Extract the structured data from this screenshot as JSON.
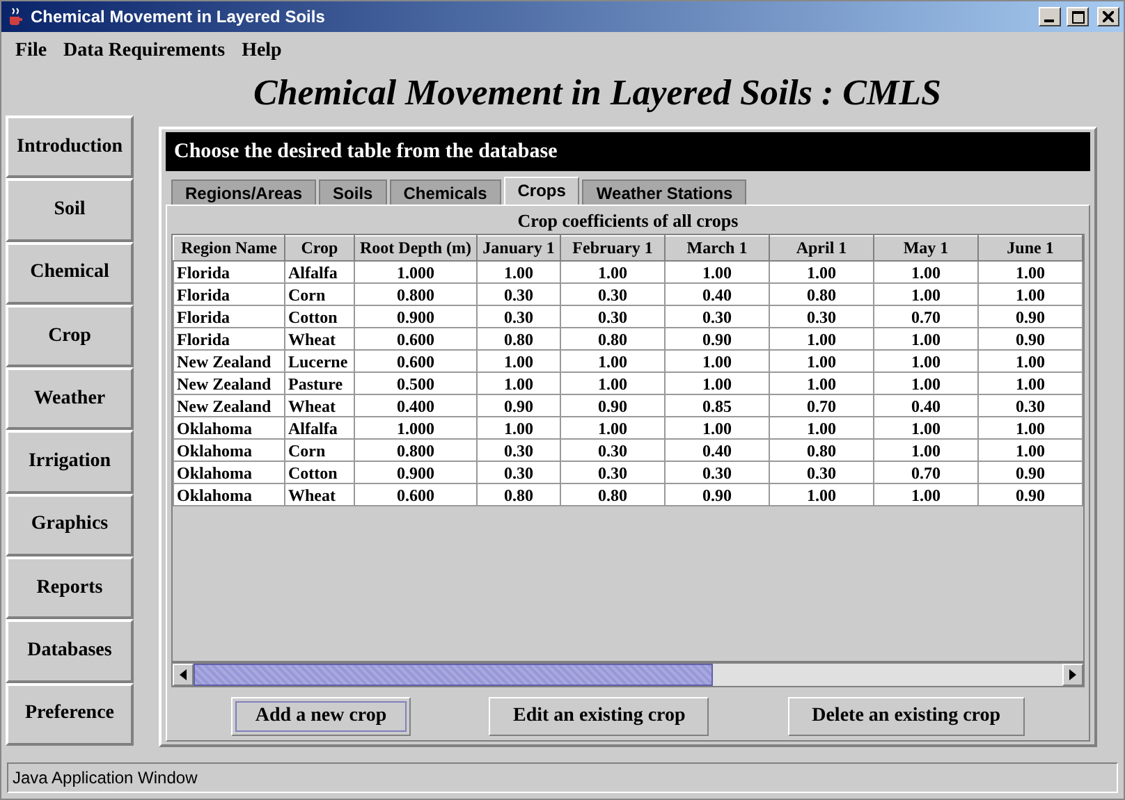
{
  "window": {
    "title": "Chemical Movement in Layered Soils"
  },
  "menu": [
    "File",
    "Data Requirements",
    "Help"
  ],
  "heading": "Chemical Movement in Layered Soils : CMLS",
  "sidebar": {
    "items": [
      "Introduction",
      "Soil",
      "Chemical",
      "Crop",
      "Weather",
      "Irrigation",
      "Graphics",
      "Reports",
      "Databases",
      "Preference"
    ]
  },
  "panel": {
    "header": "Choose the desired table from the database",
    "tabs": [
      {
        "label": "Regions/Areas",
        "selected": false
      },
      {
        "label": "Soils",
        "selected": false
      },
      {
        "label": "Chemicals",
        "selected": false
      },
      {
        "label": "Crops",
        "selected": true
      },
      {
        "label": "Weather Stations",
        "selected": false
      }
    ],
    "table": {
      "title": "Crop coefficients of all crops",
      "columns": [
        "Region Name",
        "Crop",
        "Root Depth (m)",
        "January 1",
        "February 1",
        "March 1",
        "April 1",
        "May 1",
        "June 1"
      ],
      "rows": [
        [
          "Florida",
          "Alfalfa",
          "1.000",
          "1.00",
          "1.00",
          "1.00",
          "1.00",
          "1.00",
          "1.00"
        ],
        [
          "Florida",
          "Corn",
          "0.800",
          "0.30",
          "0.30",
          "0.40",
          "0.80",
          "1.00",
          "1.00"
        ],
        [
          "Florida",
          "Cotton",
          "0.900",
          "0.30",
          "0.30",
          "0.30",
          "0.30",
          "0.70",
          "0.90"
        ],
        [
          "Florida",
          "Wheat",
          "0.600",
          "0.80",
          "0.80",
          "0.90",
          "1.00",
          "1.00",
          "0.90"
        ],
        [
          "New Zealand",
          "Lucerne",
          "0.600",
          "1.00",
          "1.00",
          "1.00",
          "1.00",
          "1.00",
          "1.00"
        ],
        [
          "New Zealand",
          "Pasture",
          "0.500",
          "1.00",
          "1.00",
          "1.00",
          "1.00",
          "1.00",
          "1.00"
        ],
        [
          "New Zealand",
          "Wheat",
          "0.400",
          "0.90",
          "0.90",
          "0.85",
          "0.70",
          "0.40",
          "0.30"
        ],
        [
          "Oklahoma",
          "Alfalfa",
          "1.000",
          "1.00",
          "1.00",
          "1.00",
          "1.00",
          "1.00",
          "1.00"
        ],
        [
          "Oklahoma",
          "Corn",
          "0.800",
          "0.30",
          "0.30",
          "0.40",
          "0.80",
          "1.00",
          "1.00"
        ],
        [
          "Oklahoma",
          "Cotton",
          "0.900",
          "0.30",
          "0.30",
          "0.30",
          "0.30",
          "0.70",
          "0.90"
        ],
        [
          "Oklahoma",
          "Wheat",
          "0.600",
          "0.80",
          "0.80",
          "0.90",
          "1.00",
          "1.00",
          "0.90"
        ]
      ]
    },
    "buttons": [
      {
        "label": "Add a new crop",
        "focused": true
      },
      {
        "label": "Edit an existing crop",
        "focused": false
      },
      {
        "label": "Delete an existing crop",
        "focused": false
      }
    ]
  },
  "status_bar": "Java Application Window"
}
